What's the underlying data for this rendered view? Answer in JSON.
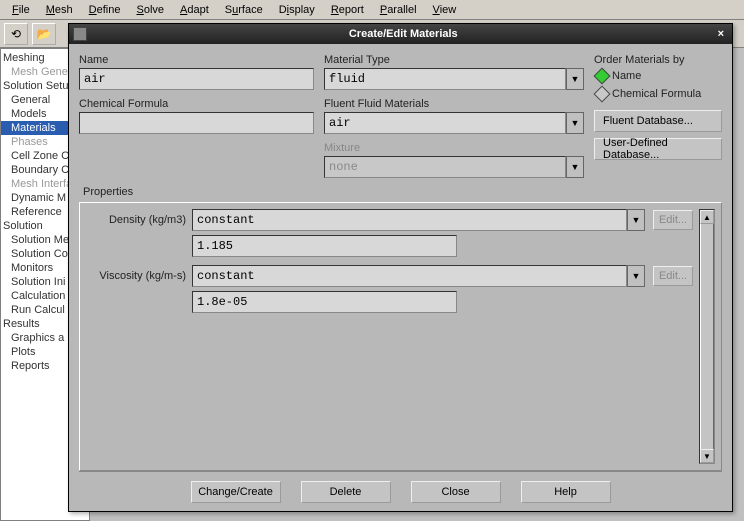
{
  "menu": [
    "File",
    "Mesh",
    "Define",
    "Solve",
    "Adapt",
    "Surface",
    "Display",
    "Report",
    "Parallel",
    "View"
  ],
  "tree": {
    "groups": [
      {
        "label": "Meshing",
        "items": [
          {
            "label": "Mesh Gene",
            "dim": true
          }
        ]
      },
      {
        "label": "Solution Setu",
        "items": [
          {
            "label": "General"
          },
          {
            "label": "Models"
          },
          {
            "label": "Materials",
            "sel": true
          },
          {
            "label": "Phases",
            "dim": true
          },
          {
            "label": "Cell Zone C"
          },
          {
            "label": "Boundary C"
          },
          {
            "label": "Mesh Interfa",
            "dim": true
          },
          {
            "label": "Dynamic M"
          },
          {
            "label": "Reference"
          }
        ]
      },
      {
        "label": "Solution",
        "items": [
          {
            "label": "Solution Me"
          },
          {
            "label": "Solution Co"
          },
          {
            "label": "Monitors"
          },
          {
            "label": "Solution Ini"
          },
          {
            "label": "Calculation"
          },
          {
            "label": "Run Calcul"
          }
        ]
      },
      {
        "label": "Results",
        "items": [
          {
            "label": "Graphics a"
          },
          {
            "label": "Plots"
          },
          {
            "label": "Reports"
          }
        ]
      }
    ]
  },
  "dialog": {
    "title": "Create/Edit Materials",
    "name_label": "Name",
    "name_value": "air",
    "chem_label": "Chemical Formula",
    "chem_value": "",
    "mattype_label": "Material Type",
    "mattype_value": "fluid",
    "fluent_label": "Fluent Fluid Materials",
    "fluent_value": "air",
    "mixture_label": "Mixture",
    "mixture_value": "none",
    "order_label": "Order Materials by",
    "order_opt1": "Name",
    "order_opt2": "Chemical Formula",
    "fluent_db_btn": "Fluent Database...",
    "user_db_btn": "User-Defined Database...",
    "props_label": "Properties",
    "density_label": "Density (kg/m3)",
    "density_method": "constant",
    "density_value": "1.185",
    "visc_label": "Viscosity (kg/m-s)",
    "visc_method": "constant",
    "visc_value": "1.8e-05",
    "edit_btn": "Edit...",
    "btn_change": "Change/Create",
    "btn_delete": "Delete",
    "btn_close": "Close",
    "btn_help": "Help"
  }
}
